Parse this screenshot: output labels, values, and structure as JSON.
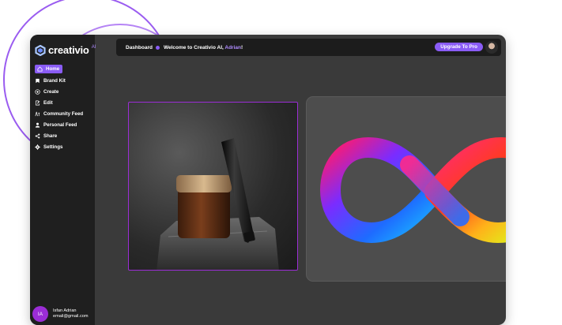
{
  "brand": {
    "name": "creativio",
    "suffix": "AI"
  },
  "sidebar": {
    "items": [
      {
        "label": "Home",
        "icon": "home-icon",
        "active": true
      },
      {
        "label": "Brand Kit",
        "icon": "brand-kit-icon"
      },
      {
        "label": "Create",
        "icon": "create-icon"
      },
      {
        "label": "Edit",
        "icon": "edit-icon"
      },
      {
        "label": "Community Feed",
        "icon": "community-icon"
      },
      {
        "label": "Personal Feed",
        "icon": "person-icon"
      },
      {
        "label": "Share",
        "icon": "share-icon"
      },
      {
        "label": "Settings",
        "icon": "gear-icon"
      }
    ]
  },
  "user": {
    "initials": "IA",
    "name": "Isfan Adrian",
    "email": "email@gmail.com"
  },
  "header": {
    "breadcrumb": "Dashboard",
    "welcome_prefix": "Welcome to Creativio AI, ",
    "welcome_name": "Adrian",
    "welcome_suffix": "!",
    "upgrade_label": "Upgrade To Pro"
  },
  "colors": {
    "accent": "#8a5cf6",
    "sidebar": "#1f1f1f",
    "panel": "#3a3a3a"
  }
}
